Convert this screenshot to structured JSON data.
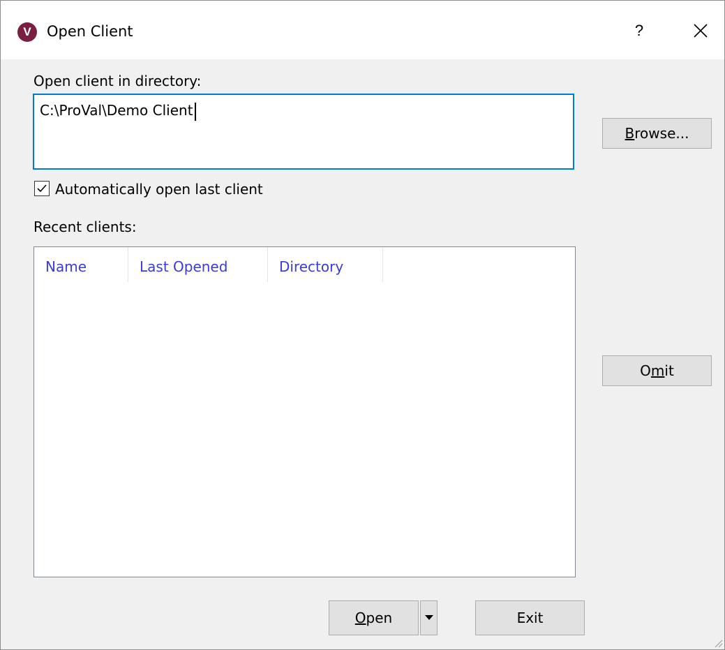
{
  "window": {
    "title": "Open Client",
    "app_icon_letter": "V",
    "help_glyph": "?",
    "close_glyph": "✕"
  },
  "directory": {
    "label": "Open client in directory:",
    "value": "C:\\ProVal\\Demo Client"
  },
  "browse_button": {
    "underlined": "B",
    "rest": "rowse..."
  },
  "auto_open": {
    "checked": true,
    "label": "Automatically open last client"
  },
  "recent": {
    "label": "Recent clients:",
    "columns": [
      "Name",
      "Last Opened",
      "Directory"
    ],
    "rows": []
  },
  "omit_button": {
    "before": "O",
    "underlined": "m",
    "after": "it"
  },
  "open_button": {
    "underlined": "O",
    "rest": "pen"
  },
  "exit_button": {
    "label": "Exit"
  },
  "colors": {
    "accent_border": "#0078d7",
    "column_header_text": "#3b3bd6",
    "app_icon": "#7a1f3f"
  }
}
